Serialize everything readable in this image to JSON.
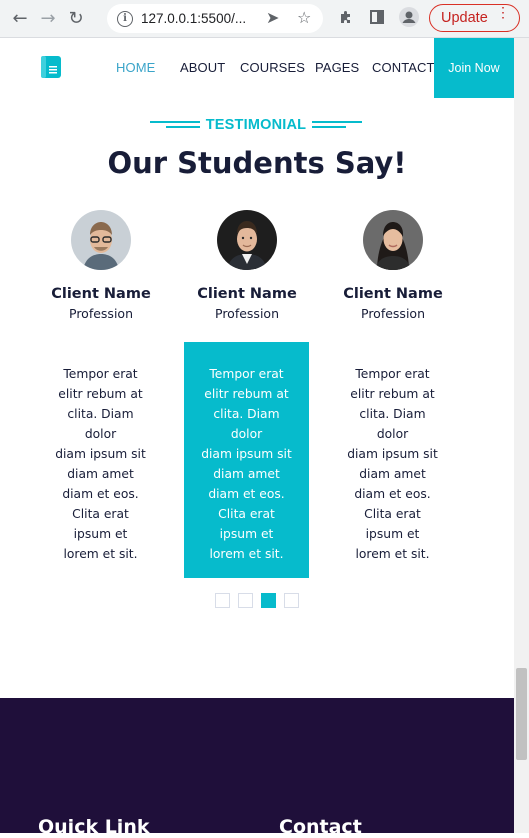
{
  "browser": {
    "url": "127.0.0.1:5500/...",
    "update_label": "Update"
  },
  "navbar": {
    "items": [
      "HOME",
      "ABOUT",
      "COURSES",
      "PAGES",
      "CONTACT"
    ],
    "join_label": "Join Now"
  },
  "testimonial": {
    "tag": "TESTIMONIAL",
    "title": "Our Students Say!",
    "cards": [
      {
        "name": "Client Name",
        "profession": "Profession",
        "quote_lines": [
          "Tempor erat",
          "elitr rebum at",
          "clita. Diam",
          "dolor",
          "diam ipsum sit",
          "diam amet",
          "diam et eos.",
          "Clita erat",
          "ipsum et",
          "lorem et sit."
        ]
      },
      {
        "name": "Client Name",
        "profession": "Profession",
        "quote_lines": [
          "Tempor erat",
          "elitr rebum at",
          "clita. Diam",
          "dolor",
          "diam ipsum sit",
          "diam amet",
          "diam et eos.",
          "Clita erat",
          "ipsum et",
          "lorem et sit."
        ]
      },
      {
        "name": "Client Name",
        "profession": "Profession",
        "quote_lines": [
          "Tempor erat",
          "elitr rebum at",
          "clita. Diam",
          "dolor",
          "diam ipsum sit",
          "diam amet",
          "diam et eos.",
          "Clita erat",
          "ipsum et",
          "lorem et sit."
        ]
      }
    ],
    "active_card": 1,
    "carousel_dots": 4,
    "active_dot": 2
  },
  "footer": {
    "headings": [
      "Quick Link",
      "Contact"
    ]
  },
  "colors": {
    "accent": "#06bbcc",
    "dark": "#181d38",
    "footer_bg": "#1f0f3a",
    "update_red": "#d93025"
  }
}
